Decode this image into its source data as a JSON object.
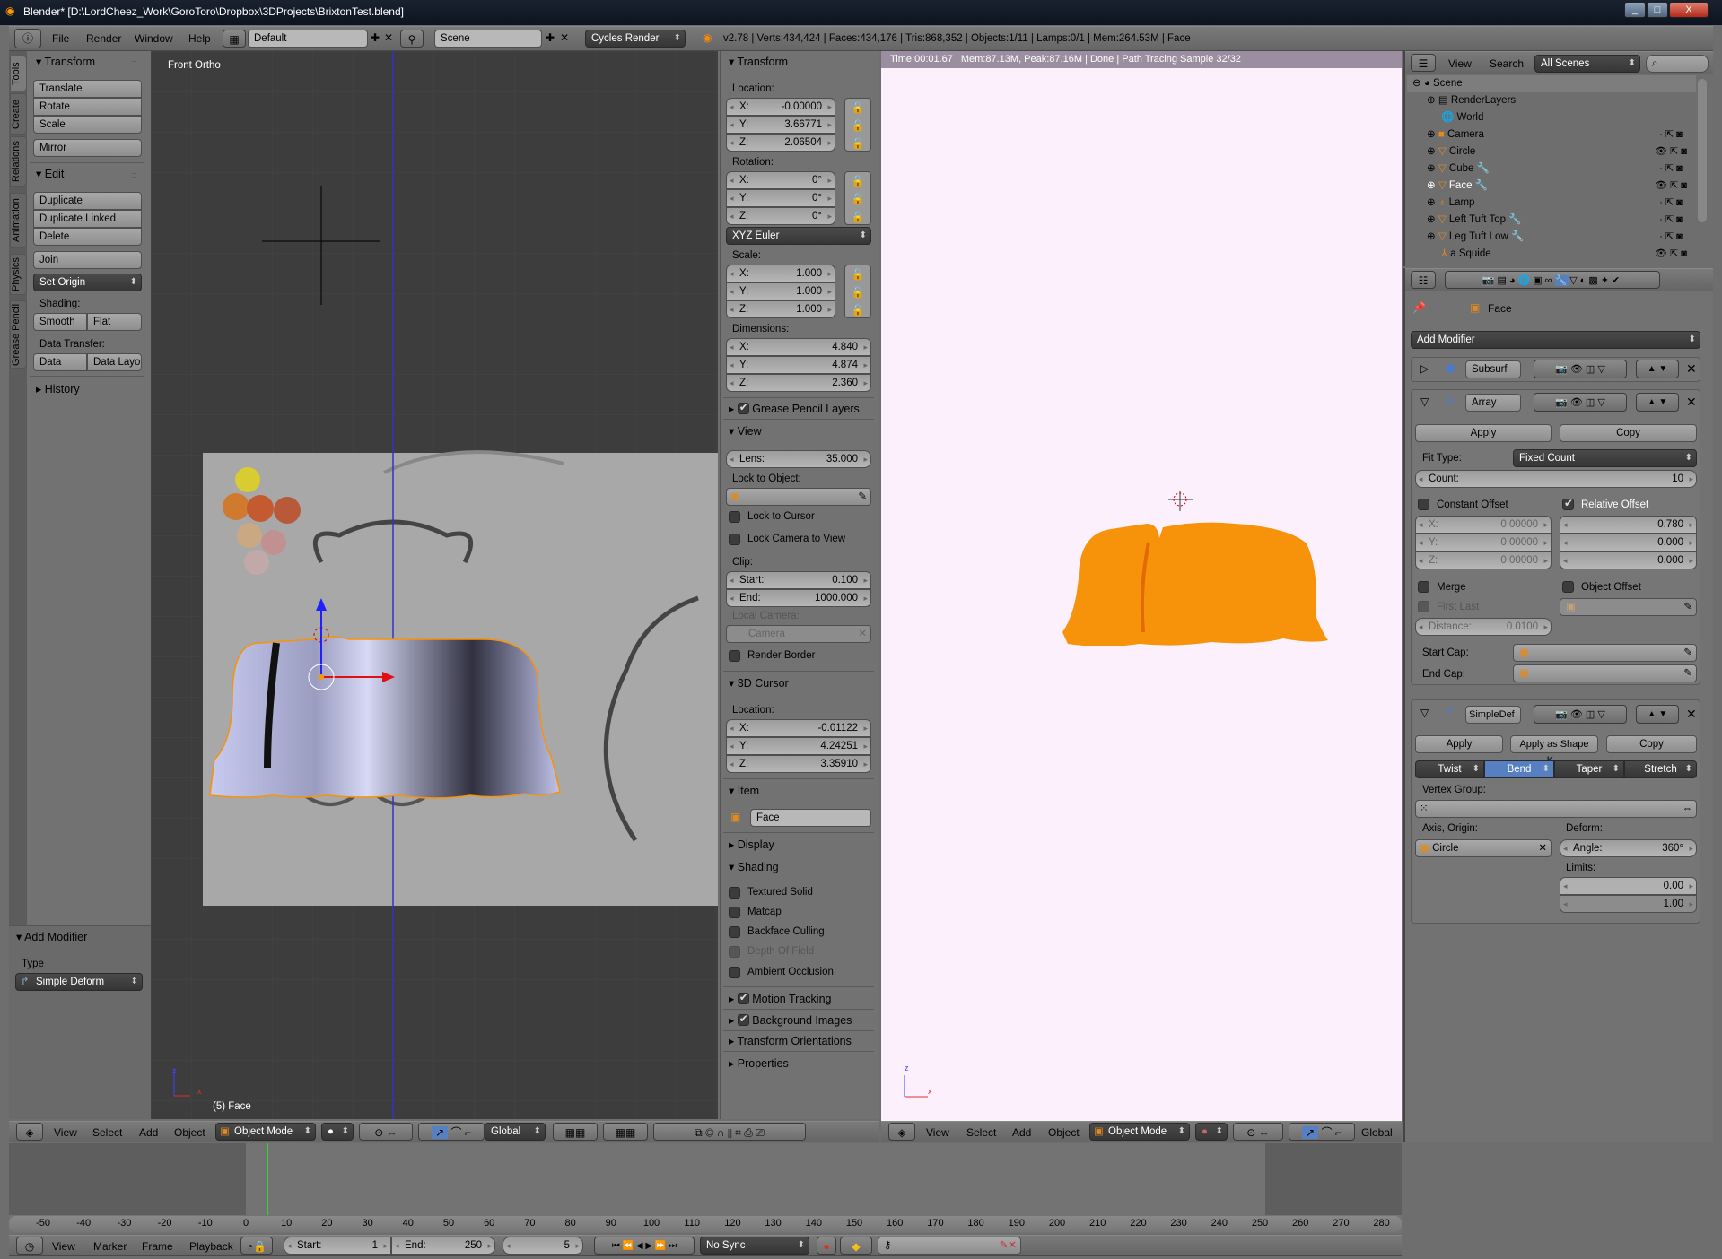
{
  "title": "Blender* [D:\\LordCheez_Work\\GoroToro\\Dropbox\\3DProjects\\BrixtonTest.blend]",
  "window_controls": [
    "_",
    "□",
    "X"
  ],
  "topbar": {
    "menus": [
      "File",
      "Render",
      "Window",
      "Help"
    ],
    "layout": "Default",
    "scene": "Scene",
    "engine": "Cycles Render",
    "stats": "v2.78 | Verts:434,424 | Faces:434,176 | Tris:868,352 | Objects:1/11 | Lamps:0/1 | Mem:264.53M | Face"
  },
  "toolshelf": {
    "tabs": [
      "Tools",
      "Create",
      "Relations",
      "Animation",
      "Physics",
      "Grease Pencil"
    ],
    "transform": {
      "header": "Transform",
      "buttons": [
        "Translate",
        "Rotate",
        "Scale",
        "Mirror"
      ]
    },
    "edit": {
      "header": "Edit",
      "buttons": [
        "Duplicate",
        "Duplicate Linked",
        "Delete",
        "Join"
      ],
      "set_origin": "Set Origin",
      "shading_label": "Shading:",
      "shading": [
        "Smooth",
        "Flat"
      ],
      "data_transfer_label": "Data Transfer:",
      "data_transfer": [
        "Data",
        "Data Layo"
      ]
    },
    "history": "History",
    "add_modifier": {
      "header": "Add Modifier",
      "type_label": "Type",
      "type_value": "Simple Deform"
    }
  },
  "viewport": {
    "label": "Front Ortho",
    "object_label": "(5) Face",
    "axis": {
      "z": "z",
      "x": "x"
    },
    "header": {
      "menus": [
        "View",
        "Select",
        "Add",
        "Object"
      ],
      "mode": "Object Mode",
      "orientation": "Global"
    }
  },
  "npanel": {
    "transform": {
      "header": "Transform",
      "location_label": "Location:",
      "location": [
        [
          "X:",
          "-0.00000"
        ],
        [
          "Y:",
          "3.66771"
        ],
        [
          "Z:",
          "2.06504"
        ]
      ],
      "rotation_label": "Rotation:",
      "rotation": [
        [
          "X:",
          "0°"
        ],
        [
          "Y:",
          "0°"
        ],
        [
          "Z:",
          "0°"
        ]
      ],
      "rotation_mode": "XYZ Euler",
      "scale_label": "Scale:",
      "scale": [
        [
          "X:",
          "1.000"
        ],
        [
          "Y:",
          "1.000"
        ],
        [
          "Z:",
          "1.000"
        ]
      ],
      "dimensions_label": "Dimensions:",
      "dimensions": [
        [
          "X:",
          "4.840"
        ],
        [
          "Y:",
          "4.874"
        ],
        [
          "Z:",
          "2.360"
        ]
      ]
    },
    "grease_pencil": "Grease Pencil Layers",
    "view": {
      "header": "View",
      "lens": [
        "Lens:",
        "35.000"
      ],
      "lock_object_label": "Lock to Object:",
      "lock_cursor": "Lock to Cursor",
      "lock_camera": "Lock Camera to View",
      "clip_label": "Clip:",
      "clip_start": [
        "Start:",
        "0.100"
      ],
      "clip_end": [
        "End:",
        "1000.000"
      ],
      "local_camera_label": "Local Camera:",
      "local_camera": "Camera",
      "render_border": "Render Border"
    },
    "cursor": {
      "header": "3D Cursor",
      "location_label": "Location:",
      "location": [
        [
          "X:",
          "-0.01122"
        ],
        [
          "Y:",
          "4.24251"
        ],
        [
          "Z:",
          "3.35910"
        ]
      ]
    },
    "item": {
      "header": "Item",
      "name": "Face"
    },
    "display": "Display",
    "shading": {
      "header": "Shading",
      "options": [
        "Textured Solid",
        "Matcap",
        "Backface Culling",
        "Depth Of Field",
        "Ambient Occlusion"
      ]
    },
    "motion_tracking": "Motion Tracking",
    "background_images": "Background Images",
    "transform_orientations": "Transform Orientations",
    "properties": "Properties"
  },
  "render": {
    "status": "Time:00:01.67 | Mem:87.13M, Peak:87.16M | Done | Path Tracing Sample 32/32",
    "bg": "#fdf0fd",
    "object_color": "#f7930a",
    "axis": {
      "z": "z",
      "x": "x"
    },
    "header": {
      "menus": [
        "View",
        "Select",
        "Add",
        "Object"
      ],
      "mode": "Object Mode",
      "orientation": "Global"
    }
  },
  "outliner": {
    "view": "View",
    "search": "Search",
    "filter": "All Scenes",
    "items": [
      {
        "name": "Scene",
        "icon": "scene-icon"
      },
      {
        "name": "RenderLayers",
        "icon": "render-layers-icon"
      },
      {
        "name": "World",
        "icon": "world-icon"
      },
      {
        "name": "Camera",
        "icon": "camera-icon"
      },
      {
        "name": "Circle",
        "icon": "mesh-icon",
        "visible": true
      },
      {
        "name": "Cube",
        "icon": "mesh-icon",
        "modifier": true
      },
      {
        "name": "Face",
        "icon": "mesh-icon",
        "modifier": true,
        "visible": true,
        "active": true
      },
      {
        "name": "Lamp",
        "icon": "lamp-icon"
      },
      {
        "name": "Left Tuft Top",
        "icon": "mesh-icon",
        "modifier": true
      },
      {
        "name": "Leg Tuft Low",
        "icon": "mesh-icon",
        "modifier": true
      },
      {
        "name": "a Squide",
        "icon": "empty-icon",
        "visible": true
      }
    ]
  },
  "properties": {
    "breadcrumb": "Face",
    "add_modifier": "Add Modifier",
    "subsurf": {
      "name": "Subsurf"
    },
    "array": {
      "name": "Array",
      "apply": "Apply",
      "copy": "Copy",
      "fit_type_label": "Fit Type:",
      "fit_type": "Fixed Count",
      "count": [
        "Count:",
        "10"
      ],
      "constant_offset": "Constant Offset",
      "relative_offset": "Relative Offset",
      "constant": [
        [
          "X:",
          "0.00000"
        ],
        [
          "Y:",
          "0.00000"
        ],
        [
          "Z:",
          "0.00000"
        ]
      ],
      "relative": [
        "0.780",
        "0.000",
        "0.000"
      ],
      "merge": "Merge",
      "object_offset": "Object Offset",
      "first_last": "First Last",
      "distance": [
        "Distance:",
        "0.0100"
      ],
      "start_cap": "Start Cap:",
      "end_cap": "End Cap:"
    },
    "simpledef": {
      "name": "SimpleDef",
      "apply": "Apply",
      "apply_shape": "Apply as Shape K...",
      "copy": "Copy",
      "modes": [
        "Twist",
        "Bend",
        "Taper",
        "Stretch"
      ],
      "active_mode": "Bend",
      "vertex_group_label": "Vertex Group:",
      "axis_origin_label": "Axis, Origin:",
      "axis_origin": "Circle",
      "deform_label": "Deform:",
      "angle": [
        "Angle:",
        "360°"
      ],
      "limits_label": "Limits:",
      "limits": [
        "0.00",
        "1.00"
      ]
    }
  },
  "timeline": {
    "ticks": [
      -50,
      -40,
      -30,
      -20,
      -10,
      0,
      10,
      20,
      30,
      40,
      50,
      60,
      70,
      80,
      90,
      100,
      110,
      120,
      130,
      140,
      150,
      160,
      170,
      180,
      190,
      200,
      210,
      220,
      230,
      240,
      250,
      260,
      270,
      280
    ],
    "current_frame": 5,
    "header": {
      "menus": [
        "View",
        "Marker",
        "Frame",
        "Playback"
      ],
      "start": [
        "Start:",
        "1"
      ],
      "end": [
        "End:",
        "250"
      ],
      "frame": "5",
      "sync": "No Sync"
    }
  },
  "colors": {
    "accent": "#5680c2",
    "viewport_bg": "#3d3d3d",
    "panel_bg": "#727272",
    "frame_line": "#3ccc3c"
  }
}
